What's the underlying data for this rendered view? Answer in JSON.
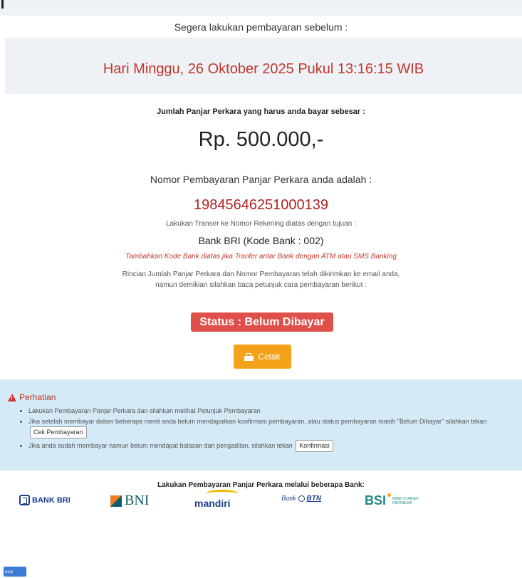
{
  "header": {
    "pay_before_label": "Segera lakukan pembayaran sebelum :",
    "deadline": "Hari Minggu, 26 Oktober 2025 Pukul 13:16:15 WIB"
  },
  "payment": {
    "amount_label": "Jumlah Panjar Perkara yang harus anda bayar sebesar :",
    "amount": "Rp. 500.000,-",
    "number_label": "Nomor Pembayaran Panjar Perkara anda adalah :",
    "number": "19845646251000139",
    "transfer_label": "Lakukan Transer ke Nomor Rekening diatas dengan tujuan :",
    "bank": "Bank BRI (Kode Bank : 002)",
    "bank_note": "Tambahkan Kode Bank diatas jika Tranfer antar Bank dengan ATM atau SMS Banking",
    "details_line1": "Rincian Jumlah Panjar Perkara dan Nomor Pembayaran telah dikirimkan ke email anda,",
    "details_line2": "namun demikian silahkan baca petunjuk cara pembayaran berikut :",
    "status": "Status : Belum Dibayar",
    "print_label": "Cetak"
  },
  "notice": {
    "title": "Perhatian",
    "item1": "Lakukan Pembayaran Panjar Perkara dan silahkan melihat Petunjuk Pembayaran",
    "item2": "Jika setelah membayar dalam beberapa menit anda belum mendapatkan konfirmasi pembayaran, atau status pembayaran masih \"Belum Dibayar\" silahkan tekan",
    "check_button": "Cek Pembayaran",
    "item3": "Jika anda sudah membayar namun belum mendapat balasan dari pengadilan, silahkan tekan",
    "confirm_button": "Konfirmasi"
  },
  "banks": {
    "label": "Lakukan Pembayaran Panjar Perkara melalui beberapa Bank:",
    "bri": "BANK BRI",
    "bni": "BNI",
    "mandiri": "mandiri",
    "btn_bank": "Bank",
    "btn_name": "BTN",
    "bsi": "BSI",
    "bsi_sub": "BANK SYARIAH INDONESIA"
  },
  "floating_button": "esai",
  "colors": {
    "deadline": "#c0392b",
    "status": "#e0504a",
    "print": "#f5a21b",
    "notice_bg": "#d4ebf7"
  }
}
